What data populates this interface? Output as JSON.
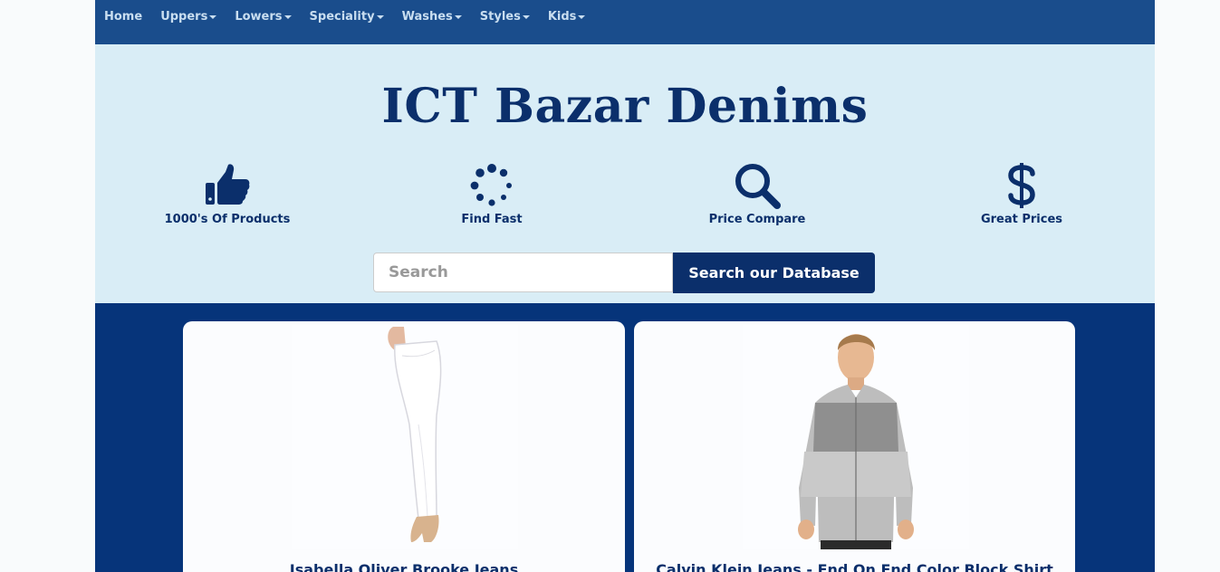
{
  "nav": {
    "items": [
      {
        "label": "Home",
        "dropdown": false
      },
      {
        "label": "Uppers",
        "dropdown": true
      },
      {
        "label": "Lowers",
        "dropdown": true
      },
      {
        "label": "Speciality",
        "dropdown": true
      },
      {
        "label": "Washes",
        "dropdown": true
      },
      {
        "label": "Styles",
        "dropdown": true
      },
      {
        "label": "Kids",
        "dropdown": true
      }
    ]
  },
  "hero": {
    "title": "ICT Bazar Denims",
    "features": [
      {
        "label": "1000's Of Products",
        "icon": "thumbs-up-icon"
      },
      {
        "label": "Find Fast",
        "icon": "spinner-icon"
      },
      {
        "label": "Price Compare",
        "icon": "search-icon"
      },
      {
        "label": "Great Prices",
        "icon": "dollar-icon"
      }
    ]
  },
  "search": {
    "placeholder": "Search",
    "button_label": "Search our Database"
  },
  "products": [
    {
      "title": "Isabella Oliver Brooke Jeans"
    },
    {
      "title": "Calvin Klein Jeans - End On End Color Block Shirt"
    }
  ],
  "colors": {
    "nav_bg": "#1a4d8c",
    "hero_bg": "#d9edf6",
    "brand_navy": "#0b2f6b",
    "products_bg": "#06347a"
  }
}
